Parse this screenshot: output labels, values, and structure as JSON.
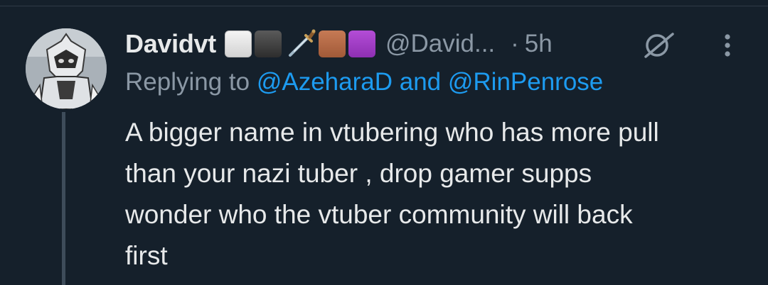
{
  "tweet": {
    "display_name": "Davidvt",
    "name_emojis": [
      "white-square",
      "black-square",
      "dagger",
      "brown-square",
      "purple-square"
    ],
    "handle": "@David...",
    "separator": "·",
    "time": "5h",
    "replying_prefix": "Replying to ",
    "mention_1": "@AzeharaD",
    "replying_joiner": " and ",
    "mention_2": "@RinPenrose",
    "text": "A bigger name in vtubering who has more pull\nthan your nazi tuber , drop gamer supps\nwonder who the vtuber community will back\nfirst"
  },
  "icons": {
    "grok": "grok-icon",
    "more": "more-vertical-icon"
  },
  "colors": {
    "background": "#15202b",
    "primary_text": "#e7e9ea",
    "secondary_text": "#8b98a5",
    "link": "#1d9bf0",
    "thread_line": "#3e4c5a"
  }
}
